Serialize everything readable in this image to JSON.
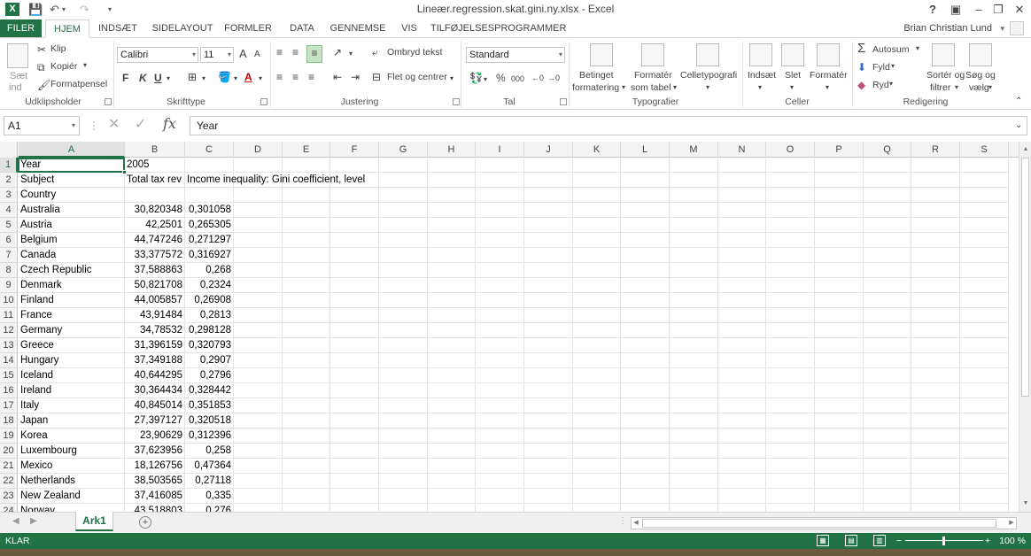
{
  "titlebar": {
    "title": "Lineær.regression.skat.gini.ny.xlsx - Excel",
    "help_btn": "?",
    "ribbon_opt_icon": "ribbon-display-icon",
    "minimize_icon": "minimize-icon",
    "restore_icon": "restore-icon",
    "close_icon": "close-icon"
  },
  "tabs": {
    "file": "FILER",
    "items": [
      "HJEM",
      "INDSÆT",
      "SIDELAYOUT",
      "FORMLER",
      "DATA",
      "GENNEMSE",
      "VIS",
      "TILFØJELSESPROGRAMMER"
    ],
    "active": "HJEM",
    "user": "Brian Christian Lund"
  },
  "ribbon": {
    "clipboard": {
      "label": "Udklipsholder",
      "paste_top": "Sæt",
      "paste_bottom": "ind",
      "cut": "Klip",
      "copy": "Kopiér",
      "format_painter": "Formatpensel"
    },
    "font": {
      "label": "Skrifttype",
      "font_name": "Calibri",
      "font_size": "11",
      "bold": "F",
      "italic": "K",
      "underline": "U",
      "grow": "A",
      "shrink": "A",
      "font_color_letter": "A"
    },
    "alignment": {
      "label": "Justering",
      "wrap_text": "Ombryd tekst",
      "merge_center": "Flet og centrer"
    },
    "number": {
      "label": "Tal",
      "format": "Standard",
      "percent": "%",
      "thousands": "000"
    },
    "styles": {
      "label": "Typografier",
      "conditional_top": "Betinget",
      "conditional_bottom": "formatering",
      "format_table_top": "Formatér",
      "format_table_bottom": "som tabel",
      "cell_styles": "Celletypografi"
    },
    "cells": {
      "label": "Celler",
      "insert": "Indsæt",
      "delete": "Slet",
      "format": "Formatér"
    },
    "editing": {
      "label": "Redigering",
      "autosum": "Autosum",
      "fill": "Fyld",
      "clear": "Ryd",
      "sort_top": "Sortér og",
      "sort_bottom": "filtrer",
      "find_top": "Søg og",
      "find_bottom": "vælg"
    }
  },
  "formula_bar": {
    "name_box": "A1",
    "fx": "fx",
    "value": "Year"
  },
  "grid": {
    "columns": [
      "A",
      "B",
      "C",
      "D",
      "E",
      "F",
      "G",
      "H",
      "I",
      "J",
      "K",
      "L",
      "M",
      "N",
      "O",
      "P",
      "Q",
      "R",
      "S"
    ],
    "selected_column": "A",
    "selected_cell": "A1",
    "rows": [
      {
        "n": "1",
        "a": "Year",
        "b": "2005",
        "c": ""
      },
      {
        "n": "2",
        "a": "Subject",
        "b": "Total tax rev",
        "c": "Income inequality: Gini coefficient, level"
      },
      {
        "n": "3",
        "a": "Country",
        "b": "",
        "c": ""
      },
      {
        "n": "4",
        "a": "Australia",
        "b": "30,820348",
        "c": "0,301058"
      },
      {
        "n": "5",
        "a": "Austria",
        "b": "42,2501",
        "c": "0,265305"
      },
      {
        "n": "6",
        "a": "Belgium",
        "b": "44,747246",
        "c": "0,271297"
      },
      {
        "n": "7",
        "a": "Canada",
        "b": "33,377572",
        "c": "0,316927"
      },
      {
        "n": "8",
        "a": "Czech Republic",
        "b": "37,588863",
        "c": "0,268"
      },
      {
        "n": "9",
        "a": "Denmark",
        "b": "50,821708",
        "c": "0,2324"
      },
      {
        "n": "10",
        "a": "Finland",
        "b": "44,005857",
        "c": "0,26908"
      },
      {
        "n": "11",
        "a": "France",
        "b": "43,91484",
        "c": "0,2813"
      },
      {
        "n": "12",
        "a": "Germany",
        "b": "34,78532",
        "c": "0,298128"
      },
      {
        "n": "13",
        "a": "Greece",
        "b": "31,396159",
        "c": "0,320793"
      },
      {
        "n": "14",
        "a": "Hungary",
        "b": "37,349188",
        "c": "0,2907"
      },
      {
        "n": "15",
        "a": "Iceland",
        "b": "40,644295",
        "c": "0,2796"
      },
      {
        "n": "16",
        "a": "Ireland",
        "b": "30,364434",
        "c": "0,328442"
      },
      {
        "n": "17",
        "a": "Italy",
        "b": "40,845014",
        "c": "0,351853"
      },
      {
        "n": "18",
        "a": "Japan",
        "b": "27,397127",
        "c": "0,320518"
      },
      {
        "n": "19",
        "a": "Korea",
        "b": "23,90629",
        "c": "0,312396"
      },
      {
        "n": "20",
        "a": "Luxembourg",
        "b": "37,623956",
        "c": "0,258"
      },
      {
        "n": "21",
        "a": "Mexico",
        "b": "18,126756",
        "c": "0,47364"
      },
      {
        "n": "22",
        "a": "Netherlands",
        "b": "38,503565",
        "c": "0,27118"
      },
      {
        "n": "23",
        "a": "New Zealand",
        "b": "37,416085",
        "c": "0,335"
      },
      {
        "n": "24",
        "a": "Norway",
        "b": "43,518803",
        "c": "0,276"
      }
    ]
  },
  "sheets": {
    "tabs": [
      "Ark1"
    ],
    "active": "Ark1",
    "add_icon": "plus-circle-icon"
  },
  "status": {
    "text": "KLAR",
    "zoom": "100 %",
    "zoom_out": "−",
    "zoom_in": "+"
  }
}
